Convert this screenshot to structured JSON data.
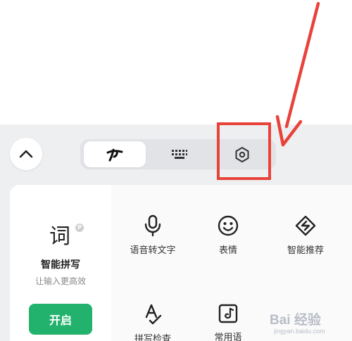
{
  "toolbar": {
    "collapse_icon": "chevron-up-icon",
    "tabs": [
      {
        "icon": "handwriting-icon",
        "active": true
      },
      {
        "icon": "keyboard-icon",
        "active": false
      },
      {
        "icon": "hexagon-settings-icon",
        "active": false
      }
    ]
  },
  "annotation": {
    "color": "#e8433b",
    "arrow_icon": "red-arrow",
    "highlight_target": "hexagon-settings-icon"
  },
  "smart_pinyin": {
    "glyph": "词",
    "badge": "P",
    "title": "智能拼写",
    "subtitle": "让输入更高效",
    "enable_label": "开启",
    "accent": "#23b26d"
  },
  "tools": [
    {
      "icon": "microphone-icon",
      "label": "语音转文字"
    },
    {
      "icon": "smiley-icon",
      "label": "表情"
    },
    {
      "icon": "smart-recommend-icon",
      "label": "智能推荐"
    },
    {
      "icon": "spell-check-icon",
      "label": "拼写检查"
    },
    {
      "icon": "phrase-icon",
      "label": "常用语"
    }
  ],
  "watermark": {
    "logo": "Bai 经验",
    "url": "jingyan.baidu.com"
  }
}
